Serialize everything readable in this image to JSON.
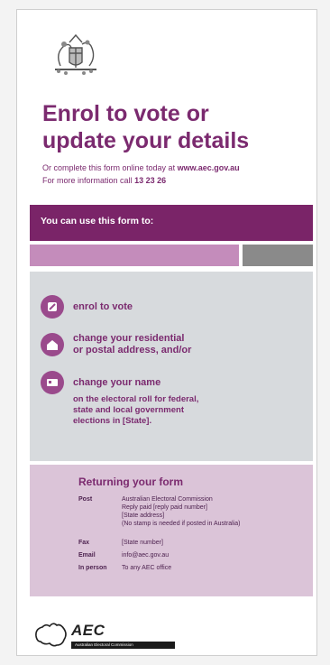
{
  "header": {
    "title_line1": "Enrol to vote or",
    "title_line2": "update your details",
    "online_text": "Or complete this form online today at",
    "online_url": "www.aec.gov.au",
    "info_text": "For more information call",
    "info_phone": "13 23 26"
  },
  "form_bar": {
    "label": "You can use this form to:"
  },
  "options": [
    {
      "label": "enrol to vote",
      "icon": "pencil-icon"
    },
    {
      "label_line1": "change your residential",
      "label_line2": "or postal address, and/or",
      "icon": "house-icon"
    },
    {
      "label": "change your name",
      "icon": "id-card-icon"
    }
  ],
  "note": {
    "line1": "on the electoral roll for federal,",
    "line2": "state and local government",
    "line3": "elections in [State]."
  },
  "returning": {
    "title": "Returning your form",
    "post_label": "Post",
    "post_line1": "Australian Electoral Commission",
    "post_line2": "Reply paid [reply paid number]",
    "post_line3": "[State address]",
    "post_line4": "(No stamp is needed if posted in Australia)",
    "fax_label": "Fax",
    "fax_value": "[State number]",
    "email_label": "Email",
    "email_value": "info@aec.gov.au",
    "inperson_label": "In person",
    "inperson_value": "To any AEC office"
  },
  "logo": {
    "name": "AEC",
    "subtitle": "Australian Electoral Commission"
  },
  "colors": {
    "brand_purple": "#7b2a6f",
    "bar_purple": "#7a2468",
    "panel_grey": "#d7dadd",
    "panel_pink": "#dbc4d8"
  }
}
